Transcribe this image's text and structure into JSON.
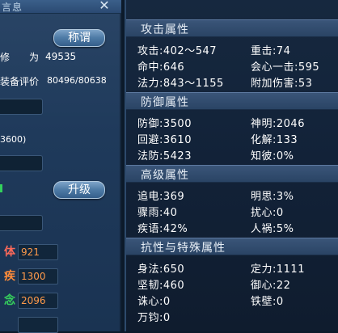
{
  "left": {
    "title": "言息",
    "title_button": "称谓",
    "cultivation_label": "修",
    "cultivation_sub": "为",
    "cultivation_value": "49535",
    "gear_label": "装备评价",
    "gear_value": "80496/80638",
    "partial_value": "3600)",
    "upgrade_button": "升级",
    "stats": [
      {
        "name": "体",
        "value": "921",
        "color": "#ff9a4a"
      },
      {
        "name": "疾",
        "value": "1300",
        "color": "#ff9a4a"
      },
      {
        "name": "念",
        "value": "2096",
        "color": "#ff9a4a"
      },
      {
        "name": "",
        "value": "",
        "color": "#ff9a4a"
      }
    ]
  },
  "right": {
    "sections": [
      {
        "title": "攻击属性",
        "rows": [
          {
            "left": "攻击:402～547",
            "right": "重击:74"
          },
          {
            "left": "命中:646",
            "right": "会心一击:595"
          },
          {
            "left": "法力:843～1155",
            "right": "附加伤害:53"
          }
        ]
      },
      {
        "title": "防御属性",
        "rows": [
          {
            "left": "防御:3500",
            "right": "神明:2046"
          },
          {
            "left": "回避:3610",
            "right": "化解:133"
          },
          {
            "left": "法防:5423",
            "right": "知彼:0%"
          }
        ]
      },
      {
        "title": "高级属性",
        "rows": [
          {
            "left": "追电:369",
            "right": "明思:3%"
          },
          {
            "left": "骤雨:40",
            "right": "扰心:0"
          },
          {
            "left": "疾语:42%",
            "right": "人祸:5%"
          }
        ]
      },
      {
        "title": "抗性与特殊属性",
        "rows": [
          {
            "left": "身法:650",
            "right": "定力:1111"
          },
          {
            "left": "坚韧:460",
            "right": "御心:22"
          },
          {
            "left": "诛心:0",
            "right": "铁壁:0"
          },
          {
            "left": "万钧:0",
            "right": ""
          }
        ]
      }
    ]
  },
  "colors": {
    "accent": "#ff9a4a",
    "stat_name_1": "#ff6a5a",
    "stat_name_2": "#ff8c3a",
    "stat_name_3": "#36d15c"
  }
}
